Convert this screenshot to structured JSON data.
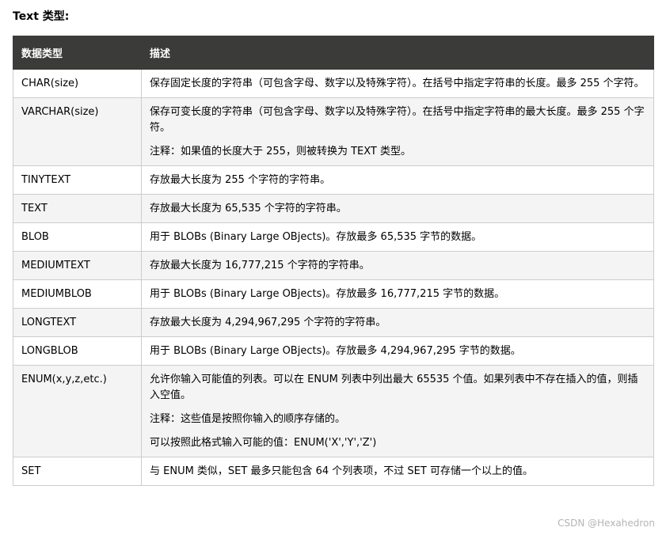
{
  "heading": "Text 类型:",
  "columns": {
    "type": "数据类型",
    "desc": "描述"
  },
  "rows": [
    {
      "type": "CHAR(size)",
      "desc": [
        "保存固定长度的字符串（可包含字母、数字以及特殊字符）。在括号中指定字符串的长度。最多 255 个字符。"
      ]
    },
    {
      "type": "VARCHAR(size)",
      "desc": [
        "保存可变长度的字符串（可包含字母、数字以及特殊字符）。在括号中指定字符串的最大长度。最多 255 个字符。",
        "注释：如果值的长度大于 255，则被转换为 TEXT 类型。"
      ]
    },
    {
      "type": "TINYTEXT",
      "desc": [
        "存放最大长度为 255 个字符的字符串。"
      ]
    },
    {
      "type": "TEXT",
      "desc": [
        "存放最大长度为 65,535 个字符的字符串。"
      ]
    },
    {
      "type": "BLOB",
      "desc": [
        "用于 BLOBs (Binary Large OBjects)。存放最多 65,535 字节的数据。"
      ]
    },
    {
      "type": "MEDIUMTEXT",
      "desc": [
        "存放最大长度为 16,777,215 个字符的字符串。"
      ]
    },
    {
      "type": "MEDIUMBLOB",
      "desc": [
        "用于 BLOBs (Binary Large OBjects)。存放最多 16,777,215 字节的数据。"
      ]
    },
    {
      "type": "LONGTEXT",
      "desc": [
        "存放最大长度为 4,294,967,295 个字符的字符串。"
      ]
    },
    {
      "type": "LONGBLOB",
      "desc": [
        "用于 BLOBs (Binary Large OBjects)。存放最多 4,294,967,295 字节的数据。"
      ]
    },
    {
      "type": "ENUM(x,y,z,etc.)",
      "desc": [
        "允许你输入可能值的列表。可以在 ENUM 列表中列出最大 65535 个值。如果列表中不存在插入的值，则插入空值。",
        "注释：这些值是按照你输入的顺序存储的。",
        "可以按照此格式输入可能的值：ENUM('X','Y','Z')"
      ]
    },
    {
      "type": "SET",
      "desc": [
        "与 ENUM 类似，SET 最多只能包含 64 个列表项，不过 SET 可存储一个以上的值。"
      ]
    }
  ],
  "watermark": "CSDN @Hexahedron"
}
